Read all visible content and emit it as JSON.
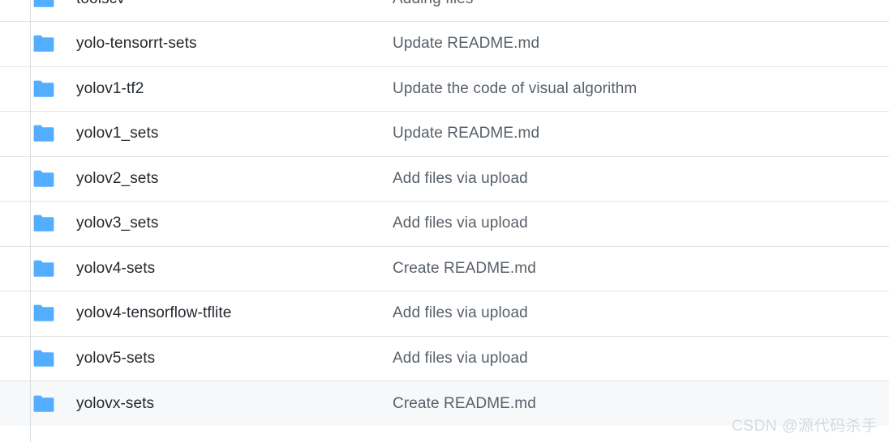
{
  "page": {
    "type": "repository-file-listing",
    "background_color": "#ffffff",
    "row_separator_color": "#e1e4e8",
    "rail_border_color": "#d8dde2",
    "hover_row_color": "#f6f8fa",
    "folder_icon_color": "#54aeff",
    "name_text_color": "#24292e",
    "message_text_color": "#586069"
  },
  "table": {
    "columns": [
      "name",
      "commit_message"
    ],
    "rows": [
      {
        "icon": "folder-icon",
        "name": "toolscv",
        "message": "Adding files",
        "hovered": false
      },
      {
        "icon": "folder-icon",
        "name": "yolo-tensorrt-sets",
        "message": "Update README.md",
        "hovered": false
      },
      {
        "icon": "folder-icon",
        "name": "yolov1-tf2",
        "message": "Update the code of visual algorithm",
        "hovered": false
      },
      {
        "icon": "folder-icon",
        "name": "yolov1_sets",
        "message": "Update README.md",
        "hovered": false
      },
      {
        "icon": "folder-icon",
        "name": "yolov2_sets",
        "message": "Add files via upload",
        "hovered": false
      },
      {
        "icon": "folder-icon",
        "name": "yolov3_sets",
        "message": "Add files via upload",
        "hovered": false
      },
      {
        "icon": "folder-icon",
        "name": "yolov4-sets",
        "message": "Create README.md",
        "hovered": false
      },
      {
        "icon": "folder-icon",
        "name": "yolov4-tensorflow-tflite",
        "message": "Add files via upload",
        "hovered": false
      },
      {
        "icon": "folder-icon",
        "name": "yolov5-sets",
        "message": "Add files via upload",
        "hovered": false
      },
      {
        "icon": "folder-icon",
        "name": "yolovx-sets",
        "message": "Create README.md",
        "hovered": true
      }
    ]
  },
  "watermark": {
    "text": "CSDN @源代码杀手"
  }
}
